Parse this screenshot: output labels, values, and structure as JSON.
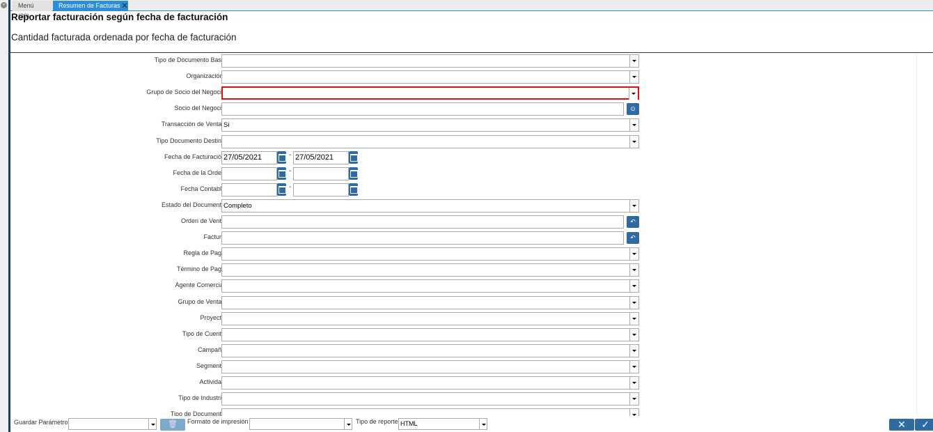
{
  "tabs": [
    {
      "label": "Menú (30)"
    },
    {
      "label": "Resumen de Facturas"
    }
  ],
  "header": {
    "title": "Reportar facturación según fecha de facturación",
    "subtitle": "Cantidad facturada ordenada por fecha de facturación"
  },
  "fields": [
    {
      "label": "Tipo de Documento Base",
      "type": "select",
      "value": ""
    },
    {
      "label": "Organización.",
      "type": "select",
      "value": ""
    },
    {
      "label": "Grupo de Socio del Negocio",
      "type": "select",
      "value": "",
      "error": true
    },
    {
      "label": "Socio del Negocio",
      "type": "search",
      "value": "",
      "icon": "search-icon"
    },
    {
      "label": "Transacción de Ventas",
      "type": "select",
      "value": "Si"
    },
    {
      "label": "Tipo Documento Destino",
      "type": "select",
      "value": ""
    },
    {
      "label": "Fecha de Facturación",
      "type": "daterange",
      "from": "27/05/2021",
      "to": "27/05/2021"
    },
    {
      "label": "Fecha de la Orden",
      "type": "daterange",
      "from": "",
      "to": ""
    },
    {
      "label": "Fecha Contable",
      "type": "daterange",
      "from": "",
      "to": ""
    },
    {
      "label": "Estado del Documento",
      "type": "select",
      "value": "Completo"
    },
    {
      "label": "Orden de Venta",
      "type": "search",
      "value": "",
      "icon": "lookup-icon"
    },
    {
      "label": "Factura",
      "type": "search",
      "value": "",
      "icon": "lookup-icon"
    },
    {
      "label": "Regla de Pago",
      "type": "select",
      "value": ""
    },
    {
      "label": "Término de Pago",
      "type": "select",
      "value": ""
    },
    {
      "label": "Agente Comercial",
      "type": "select",
      "value": ""
    },
    {
      "label": "Grupo de Ventas",
      "type": "select",
      "value": ""
    },
    {
      "label": "Proyecto",
      "type": "select",
      "value": ""
    },
    {
      "label": "Tipo de Cuenta",
      "type": "select",
      "value": ""
    },
    {
      "label": "Campaña",
      "type": "select",
      "value": ""
    },
    {
      "label": "Segmento",
      "type": "select",
      "value": ""
    },
    {
      "label": "Actividad",
      "type": "select",
      "value": ""
    },
    {
      "label": "Tipo de Industria",
      "type": "select",
      "value": ""
    },
    {
      "label": "Tipo de Documento",
      "type": "select",
      "value": ""
    }
  ],
  "footer": {
    "save_param_label": "Guardar Parámetro",
    "save_param_value": "",
    "print_format_label": "Formato de impresión",
    "print_format_value": "",
    "report_type_label": "Tipo de reporte",
    "report_type_value": "HTML"
  },
  "colors": {
    "accent": "#2a8ed8",
    "button": "#2f6aa0",
    "error": "#e01010"
  }
}
